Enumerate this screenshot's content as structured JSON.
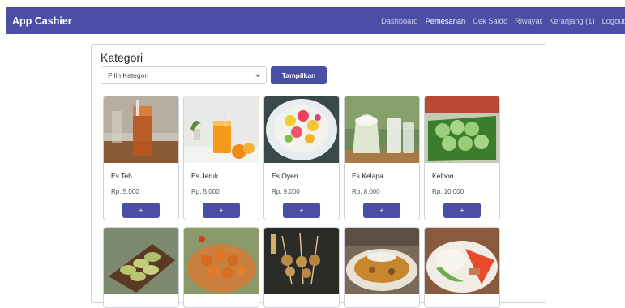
{
  "navbar": {
    "brand": "App Cashier",
    "links": [
      "Dashboard",
      "Pemesanan",
      "Cek Saldo",
      "Riwayat",
      "Keranjang (1)",
      "Logout"
    ],
    "active_link": "Pemesanan",
    "color": "#4a4ea5"
  },
  "kategori": {
    "title": "Kategori",
    "select_value": "Pilih Ketegori",
    "button_label": "Tampilkan"
  },
  "products": [
    {
      "name": "Es Teh",
      "price": "Rp. 5.000",
      "button": "+",
      "icon": "iced-tea-image"
    },
    {
      "name": "Es Jeruk",
      "price": "Rp. 5.000",
      "button": "+",
      "icon": "orange-juice-image"
    },
    {
      "name": "Es Oyen",
      "price": "Rp. 9.000",
      "button": "+",
      "icon": "es-oyen-image"
    },
    {
      "name": "Es Kelapa",
      "price": "Rp. 8.000",
      "button": "+",
      "icon": "coconut-drink-image"
    },
    {
      "name": "Kelpon",
      "price": "Rp. 10.000",
      "button": "+",
      "icon": "klepon-image"
    }
  ],
  "second_row_images": [
    "fried-banana-image",
    "meatballs-image",
    "satay-image",
    "soup-image",
    "rice-dish-image"
  ]
}
